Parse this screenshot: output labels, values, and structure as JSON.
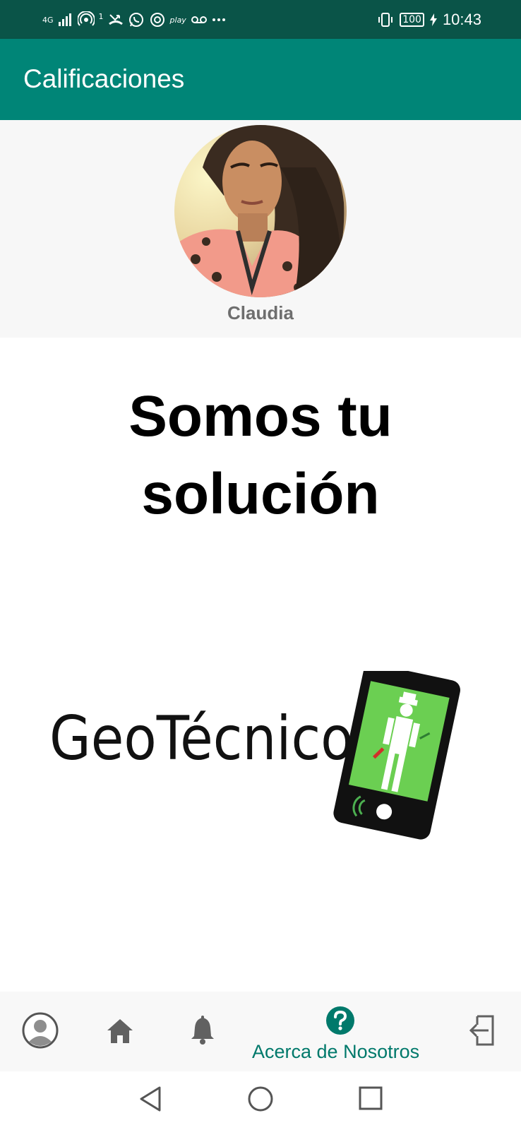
{
  "status_bar": {
    "network": "4G",
    "notification_count": "1",
    "battery": "100",
    "time": "10:43",
    "play_label": "play"
  },
  "app_bar": {
    "title": "Calificaciones"
  },
  "profile": {
    "name": "Claudia"
  },
  "hero": {
    "line1": "Somos tu",
    "line2": "solución"
  },
  "logo": {
    "text": "GeoTécnicos"
  },
  "bottom_nav": {
    "items": [
      {
        "icon": "account-circle-icon",
        "active": false
      },
      {
        "icon": "home-icon",
        "active": false
      },
      {
        "icon": "bell-icon",
        "active": false
      },
      {
        "icon": "help-circle-icon",
        "label": "Acerca de Nosotros",
        "active": true
      },
      {
        "icon": "logout-icon",
        "active": false
      }
    ]
  },
  "colors": {
    "status_bar": "#0a5448",
    "app_bar": "#008577",
    "accent": "#00796b",
    "nav_icon": "#616161"
  }
}
